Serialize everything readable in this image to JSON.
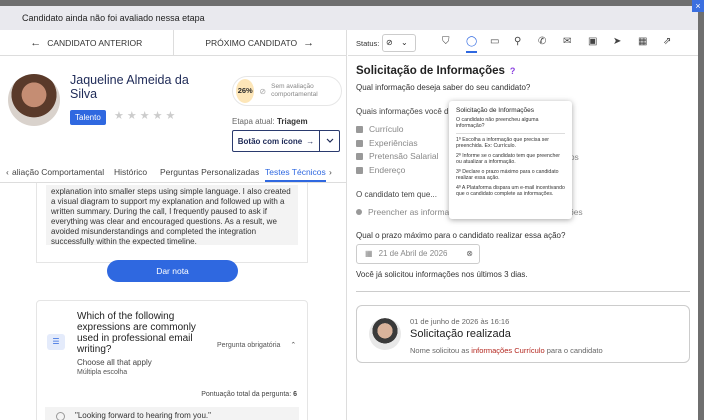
{
  "banner": {
    "text": "Candidato ainda não foi avaliado nessa etapa",
    "close_icon": "×"
  },
  "nav": {
    "prev_label": "CANDIDATO ANTERIOR",
    "next_label": "PRÓXIMO CANDIDATO",
    "prev_icon": "←",
    "next_icon": "→"
  },
  "candidate": {
    "name": "Jaqueline Almeida da Silva",
    "tag": "Talento",
    "stars": "★★★★★",
    "score_pct": "26%",
    "eval_text": "Sem avaliação comportamental",
    "stage_label": "Etapa atual:",
    "stage_value": "Triagem",
    "action_button": "Botão com ícone",
    "action_icon": "→"
  },
  "tabs": {
    "left_chevron": "‹",
    "right_chevron": "›",
    "items": [
      "aliação Comportamental",
      "Histórico",
      "Perguntas Personalizadas",
      "Testes Técnicos"
    ],
    "active": "Testes Técnicos"
  },
  "answer": {
    "text": "explanation into smaller steps using simple language. I also created a visual diagram to support my explanation and followed up with a written summary. During the call, I frequently paused to ask if everything was clear and encouraged questions. As a result, we avoided misunderstandings and completed the integration successfully within the expected timeline."
  },
  "grade_button": "Dar nota",
  "question": {
    "title": "Which of the following expressions are commonly used in professional email writing?",
    "subtitle": "Choose all that apply",
    "type": "Múltipla escolha",
    "required": "Pergunta obrigatória",
    "score_label": "Pontuação total da pergunta:",
    "score_value": "6",
    "option_1": "\"Looking forward to hearing from you.\""
  },
  "status": {
    "label": "Status:",
    "selected_icon": "eye-off-icon"
  },
  "request": {
    "title": "Solicitação de Informações",
    "help_icon": "?",
    "q1": "Qual informação deseja saber do seu candidato?",
    "q2": "Quais informações você d",
    "checklist": [
      "Currículo",
      "Experiências",
      "Pretensão Salarial",
      "Endereço"
    ],
    "q3": "O candidato tem que...",
    "radio_option": "Preencher as informaç",
    "trunc_right_1": "entos",
    "trunc_right_2": "ações",
    "q4": "Qual o prazo máximo para o candidato realizar essa ação?",
    "date_value": "21 de Abril de 2026",
    "info": "Você já solicitou informações nos últimos 3 dias."
  },
  "history": {
    "date": "01 de junho de 2026 às 16:16",
    "title": "Solicitação realizada",
    "desc_pre": "Nome solicitou as",
    "desc_highlight": "informações Currículo",
    "desc_post": "para o candidato"
  },
  "tooltip": {
    "title": "Solicitação de Informações",
    "intro": "O candidato não preencheu alguma informação?",
    "steps": [
      "1º Escolha a informação que precisa ser preenchida. Ex: Currículo.",
      "2º Informe se o candidato tem que preencher ou atualizar a informação.",
      "3º Declare o prazo máximo para o candidato realizar essa ação.",
      "4º A Plataforma dispara um e-mail incentivando que o candidato complete as informações."
    ]
  }
}
